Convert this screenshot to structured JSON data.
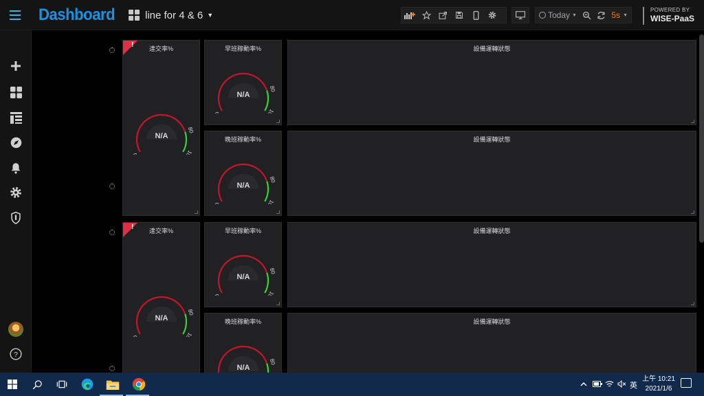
{
  "header": {
    "brand": "Dashboard",
    "dashboard_name": "line for 4 & 6",
    "time_range": "Today",
    "refresh_rate": "5s",
    "powered_by": "POWERED BY",
    "powered_brand": "WISE-PaaS"
  },
  "toolbar_icons": [
    "add-panel-icon",
    "star-icon",
    "share-icon",
    "save-icon",
    "mobile-icon",
    "gear-icon",
    "tv-icon",
    "clock-icon",
    "zoom-out-icon",
    "refresh-icon"
  ],
  "sidebar_icons": [
    "plus-icon",
    "dashboards-icon",
    "playlist-icon",
    "compass-icon",
    "bell-icon",
    "gear-icon",
    "shield-icon",
    "avatar",
    "help-icon"
  ],
  "colors": {
    "brand": "#1e90e0",
    "accent_orange": "#eb7b18",
    "gauge_red": "#c4162a",
    "gauge_green": "#37d13c",
    "alert_red": "#e02f44",
    "panel_bg": "#212124"
  },
  "rows": [
    {
      "delivery": {
        "title": "達交率%",
        "value": "N/A",
        "ticks": [
          "0",
          "80",
          "100"
        ],
        "alert": true,
        "threshold_fraction": 0.8
      },
      "early": {
        "title": "早班稼動率%",
        "value": "N/A",
        "ticks": [
          "0",
          "80",
          "100"
        ],
        "threshold_fraction": 0.8
      },
      "late": {
        "title": "晚班稼動率%",
        "value": "N/A",
        "ticks": [
          "0",
          "80",
          "100"
        ],
        "threshold_fraction": 0.8
      },
      "status1": {
        "title": "設備運轉狀態"
      },
      "status2": {
        "title": "設備運轉狀態"
      }
    },
    {
      "delivery": {
        "title": "達交率%",
        "value": "N/A",
        "ticks": [
          "0",
          "80",
          "100"
        ],
        "alert": true,
        "threshold_fraction": 0.8
      },
      "early": {
        "title": "早班稼動率%",
        "value": "N/A",
        "ticks": [
          "0",
          "80",
          "100"
        ],
        "threshold_fraction": 0.8
      },
      "late": {
        "title": "晚班稼動率%",
        "value": "N/A",
        "ticks": [
          "0",
          "80",
          "100"
        ],
        "threshold_fraction": 0.8
      },
      "status1": {
        "title": "設備運轉狀態"
      },
      "status2": {
        "title": "設備運轉狀態"
      }
    }
  ],
  "alert_mark": "!",
  "taskbar": {
    "apps": [
      "windows-start-icon",
      "search-icon",
      "task-view-icon",
      "edge-icon",
      "file-explorer-icon",
      "chrome-icon"
    ],
    "ime": "英",
    "time": "上午 10:21",
    "date": "2021/1/6"
  }
}
